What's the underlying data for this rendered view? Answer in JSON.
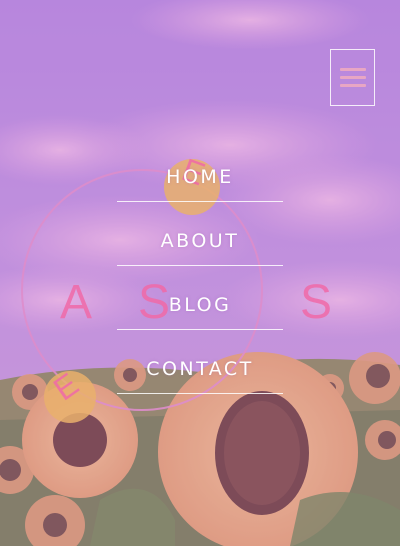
{
  "header": {
    "menu_icon": "hamburger-menu-icon"
  },
  "nav": {
    "items": [
      {
        "label": "HOME"
      },
      {
        "label": "ABOUT"
      },
      {
        "label": "BLOG"
      },
      {
        "label": "CONTACT"
      }
    ]
  },
  "logo": {
    "letters": [
      "A",
      "S",
      "S",
      "E",
      "E"
    ]
  },
  "colors": {
    "overlay": "#c478dc",
    "logo_pink": "#f06aa8",
    "logo_yellow": "#f3c14e",
    "menu_icon": "#e8a6c4",
    "text": "#ffffff"
  }
}
